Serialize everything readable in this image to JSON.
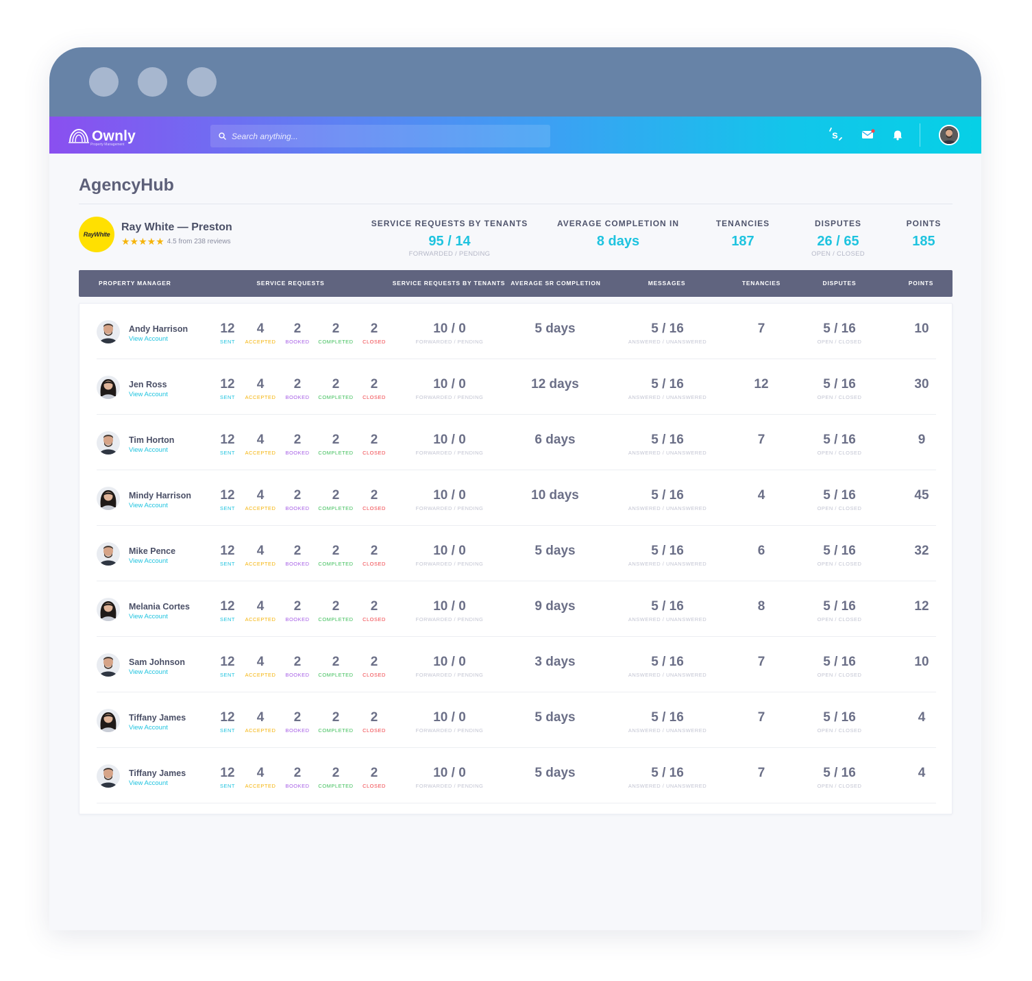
{
  "app": {
    "logo_text": "Ownly",
    "logo_subtext": "Property Management",
    "search_placeholder": "Search anything...",
    "icons": [
      "s-logo-icon",
      "mail-icon",
      "bell-icon",
      "user-avatar"
    ]
  },
  "page": {
    "title": "AgencyHub"
  },
  "agency": {
    "logo_text": "RayWhite",
    "name": "Ray White — Preston",
    "stars": "★★★★★",
    "rating_text": "4.5 from 238 reviews"
  },
  "kpis": {
    "service_requests": {
      "label": "SERVICE REQUESTS BY TENANTS",
      "value": "95 / 14",
      "sub": "FORWARDED / PENDING"
    },
    "avg_completion": {
      "label": "AVERAGE COMPLETION IN",
      "value": "8 days"
    },
    "tenancies": {
      "label": "TENANCIES",
      "value": "187"
    },
    "disputes": {
      "label": "DISPUTES",
      "value": "26 / 65",
      "sub": "OPEN / CLOSED"
    },
    "points": {
      "label": "POINTS",
      "value": "185"
    }
  },
  "table": {
    "headers": {
      "property_manager": "PROPERTY MANAGER",
      "service_requests": "SERVICE REQUESTS",
      "sr_by_tenants": "SERVICE REQUESTS BY TENANTS",
      "avg_sr_completion": "AVERAGE SR COMPLETION",
      "messages": "MESSAGES",
      "tenancies": "TENANCIES",
      "disputes": "DISPUTES",
      "points": "POINTS"
    },
    "sub_labels": {
      "sent": "SENT",
      "accepted": "ACCEPTED",
      "booked": "BOOKED",
      "completed": "COMPLETED",
      "closed": "CLOSED",
      "forwarded_pending": "FORWARDED / PENDING",
      "answered_unanswered": "ANSWERED / UNANSWERED",
      "open_closed": "OPEN / CLOSED"
    },
    "view_account_label": "View Account",
    "rows": [
      {
        "name": "Andy Harrison",
        "sent": "12",
        "accepted": "4",
        "booked": "2",
        "completed": "2",
        "closed": "2",
        "sr_tenants": "10 / 0",
        "avg": "5 days",
        "messages": "5 / 16",
        "tenancies": "7",
        "disputes": "5 / 16",
        "points": "10"
      },
      {
        "name": "Jen Ross",
        "sent": "12",
        "accepted": "4",
        "booked": "2",
        "completed": "2",
        "closed": "2",
        "sr_tenants": "10 / 0",
        "avg": "12 days",
        "messages": "5 / 16",
        "tenancies": "12",
        "disputes": "5 / 16",
        "points": "30"
      },
      {
        "name": "Tim Horton",
        "sent": "12",
        "accepted": "4",
        "booked": "2",
        "completed": "2",
        "closed": "2",
        "sr_tenants": "10 / 0",
        "avg": "6 days",
        "messages": "5 / 16",
        "tenancies": "7",
        "disputes": "5 / 16",
        "points": "9"
      },
      {
        "name": "Mindy Harrison",
        "sent": "12",
        "accepted": "4",
        "booked": "2",
        "completed": "2",
        "closed": "2",
        "sr_tenants": "10 / 0",
        "avg": "10 days",
        "messages": "5 / 16",
        "tenancies": "4",
        "disputes": "5 / 16",
        "points": "45"
      },
      {
        "name": "Mike Pence",
        "sent": "12",
        "accepted": "4",
        "booked": "2",
        "completed": "2",
        "closed": "2",
        "sr_tenants": "10 / 0",
        "avg": "5 days",
        "messages": "5 / 16",
        "tenancies": "6",
        "disputes": "5 / 16",
        "points": "32"
      },
      {
        "name": "Melania Cortes",
        "sent": "12",
        "accepted": "4",
        "booked": "2",
        "completed": "2",
        "closed": "2",
        "sr_tenants": "10 / 0",
        "avg": "9 days",
        "messages": "5 / 16",
        "tenancies": "8",
        "disputes": "5 / 16",
        "points": "12"
      },
      {
        "name": "Sam Johnson",
        "sent": "12",
        "accepted": "4",
        "booked": "2",
        "completed": "2",
        "closed": "2",
        "sr_tenants": "10 / 0",
        "avg": "3 days",
        "messages": "5 / 16",
        "tenancies": "7",
        "disputes": "5 / 16",
        "points": "10"
      },
      {
        "name": "Tiffany James",
        "sent": "12",
        "accepted": "4",
        "booked": "2",
        "completed": "2",
        "closed": "2",
        "sr_tenants": "10 / 0",
        "avg": "5 days",
        "messages": "5 / 16",
        "tenancies": "7",
        "disputes": "5 / 16",
        "points": "4"
      },
      {
        "name": "Tiffany James",
        "sent": "12",
        "accepted": "4",
        "booked": "2",
        "completed": "2",
        "closed": "2",
        "sr_tenants": "10 / 0",
        "avg": "5 days",
        "messages": "5 / 16",
        "tenancies": "7",
        "disputes": "5 / 16",
        "points": "4"
      }
    ]
  },
  "colors": {
    "brand_cyan": "#1ec3df",
    "header_bg": "#60647f",
    "chrome": "#6783a7",
    "accepted": "#f5b40c",
    "booked": "#a65ee6",
    "completed": "#3fbf5b",
    "closed": "#f0454b"
  }
}
